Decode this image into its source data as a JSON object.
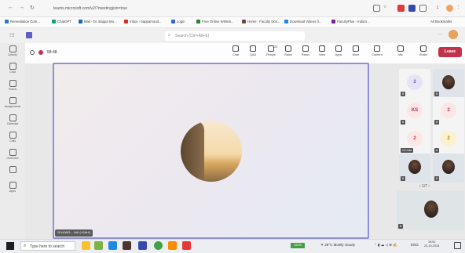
{
  "browser": {
    "url": "teams.microsoft.com/v2/?meetingjoin=true",
    "bookmarks": [
      {
        "label": "Remediation Com...",
        "color": "#2b7bd4"
      },
      {
        "label": "ChatGPT",
        "color": "#10a37f"
      },
      {
        "label": "Mail - Dr. Bappa Mo...",
        "color": "#1565c0"
      },
      {
        "label": "Inbox - bappamond...",
        "color": "#d93025"
      },
      {
        "label": "Login",
        "color": "#3367d6"
      },
      {
        "label": "Free Online Whiteb...",
        "color": "#2e7d32"
      },
      {
        "label": "Home - Faculty Dcli...",
        "color": "#6d4c41"
      },
      {
        "label": "Download Videos fr...",
        "color": "#1e88e5"
      },
      {
        "label": "FacultyPlus - India's...",
        "color": "#7b1fa2"
      }
    ],
    "all_bookmarks": "All Bookmarks"
  },
  "teams": {
    "search_placeholder": "Search (Ctrl+Alt+E)",
    "rail": [
      {
        "label": "Activity"
      },
      {
        "label": "Chat"
      },
      {
        "label": "Teams"
      },
      {
        "label": "Assignments"
      },
      {
        "label": "Calendar"
      },
      {
        "label": "Calls"
      },
      {
        "label": "OneDrive"
      },
      {
        "label": "..."
      },
      {
        "label": "Apps"
      }
    ],
    "meeting_timer": "58:48",
    "toolbar": [
      {
        "label": "Chat"
      },
      {
        "label": "Q&A"
      },
      {
        "label": "People",
        "badge": "23"
      },
      {
        "label": "Raise"
      },
      {
        "label": "React"
      },
      {
        "label": "View"
      },
      {
        "label": "Apps"
      },
      {
        "label": "More"
      },
      {
        "label": "Camera"
      },
      {
        "label": "Mic"
      },
      {
        "label": "Share"
      }
    ],
    "leave_label": "Leave",
    "main_video_name": "20140821... NAI (+SAHI)",
    "participants": [
      {
        "initials": "2",
        "bg": "#e6e4f4",
        "fg": "#5b57a6",
        "photo": false,
        "name": "B"
      },
      {
        "initials": "",
        "bg": "#d7dde6",
        "fg": "#333",
        "photo": true,
        "name": "B"
      },
      {
        "initials": "KS",
        "bg": "#fde6e6",
        "fg": "#c4314b",
        "photo": false,
        "name": "B"
      },
      {
        "initials": "2",
        "bg": "#fde6e6",
        "fg": "#c4314b",
        "photo": false,
        "name": "B"
      },
      {
        "initials": "2",
        "bg": "#fde6e6",
        "fg": "#c4314b",
        "photo": false,
        "name": "On hold"
      },
      {
        "initials": "2",
        "bg": "#fbf1cc",
        "fg": "#a67a00",
        "photo": false,
        "name": "B"
      },
      {
        "initials": "",
        "bg": "#d7dde6",
        "fg": "#333",
        "photo": true,
        "name": "B"
      },
      {
        "initials": "",
        "bg": "#d7dde6",
        "fg": "#333",
        "photo": true,
        "name": "B"
      }
    ],
    "pager": "1/7",
    "big_tile_name": "B"
  },
  "taskbar": {
    "search_placeholder": "Type here to search",
    "battery": "100%",
    "weather": "29°C Mostly cloudy",
    "lang": "ENG",
    "time": "19:51",
    "date": "23-10-2024"
  }
}
